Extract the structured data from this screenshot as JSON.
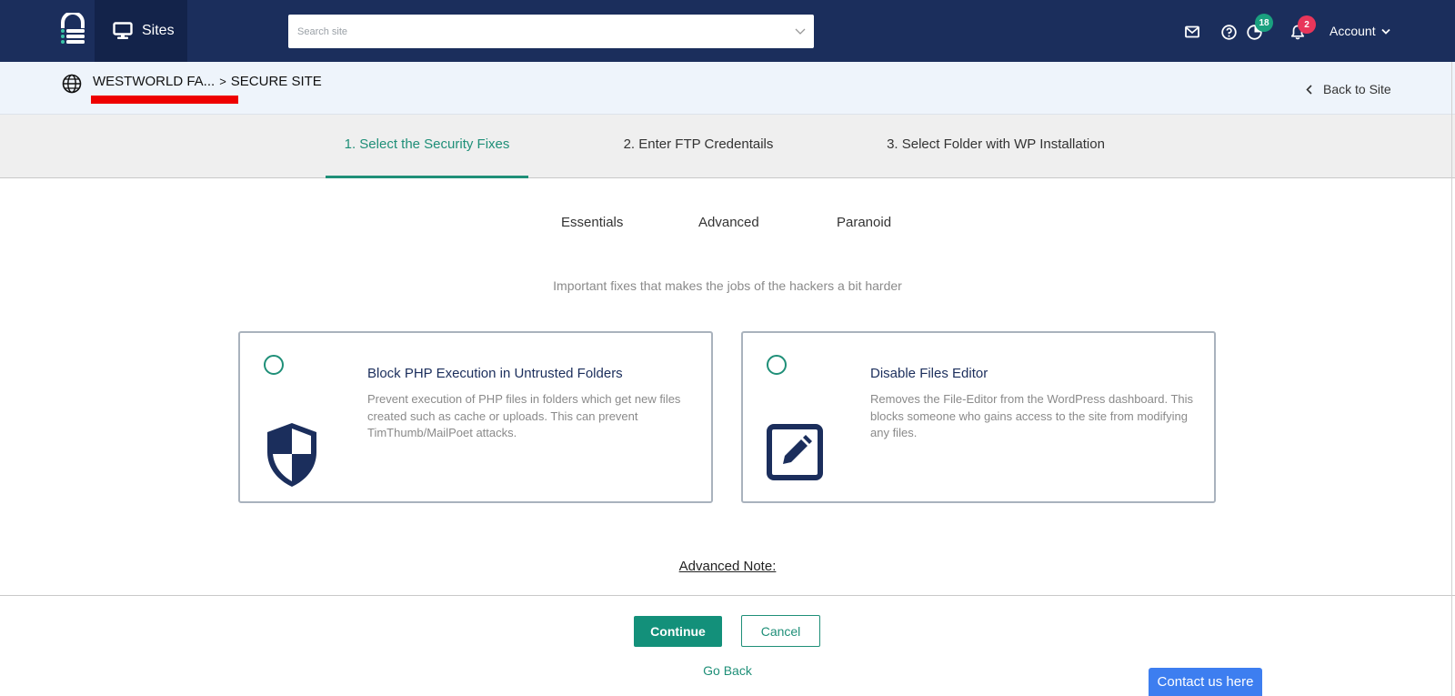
{
  "nav": {
    "sites_label": "Sites",
    "search_placeholder": "Search site",
    "status_badge": "18",
    "notifications_badge": "2",
    "account_label": "Account"
  },
  "breadcrumb": {
    "site": "WESTWORLD FA...",
    "separator": ">",
    "page": "SECURE SITE",
    "back_label": "Back to Site"
  },
  "steps": [
    {
      "label": "1. Select the Security Fixes",
      "active": true
    },
    {
      "label": "2. Enter FTP Credentails",
      "active": false
    },
    {
      "label": "3. Select Folder with WP Installation",
      "active": false
    }
  ],
  "levels": [
    "Essentials",
    "Advanced",
    "Paranoid"
  ],
  "description": "Important fixes that makes the jobs of the hackers a bit harder",
  "fixes": [
    {
      "title": "Block PHP Execution in Untrusted Folders",
      "text": "Prevent execution of PHP files in folders which get new files created such as cache or uploads. This can prevent TimThumb/MailPoet attacks.",
      "icon": "shield-icon",
      "selected": false
    },
    {
      "title": "Disable Files Editor",
      "text": "Removes the File-Editor from the WordPress dashboard. This blocks someone who gains access to the site from modifying any files.",
      "icon": "edit-icon",
      "selected": false
    }
  ],
  "advanced_note": "Advanced Note:",
  "actions": {
    "continue": "Continue",
    "cancel": "Cancel",
    "go_back": "Go Back"
  },
  "contact": "Contact us here",
  "colors": {
    "navbar": "#1b2e5c",
    "accent": "#1f8f78",
    "contact": "#3d7ef0",
    "status_badge": "#1aa07f",
    "notification_badge": "#e8365a"
  }
}
